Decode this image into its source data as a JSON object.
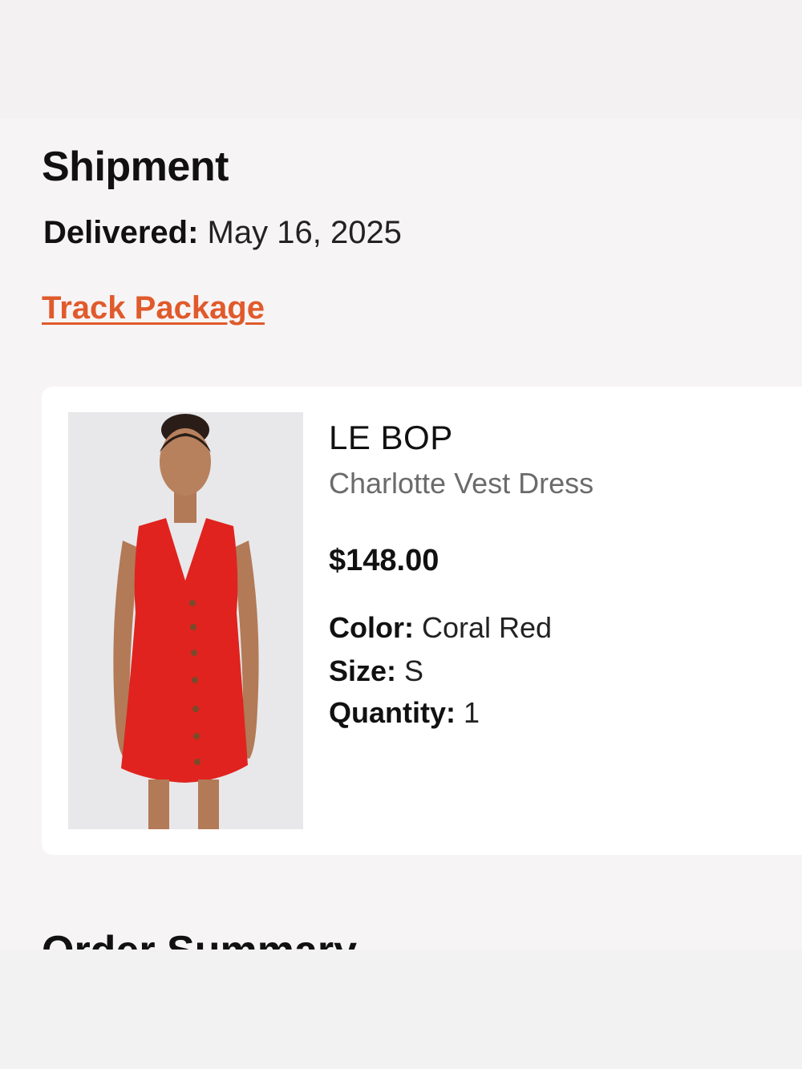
{
  "shipment": {
    "title": "Shipment",
    "delivered_label": "Delivered:",
    "delivered_date": "May 16, 2025",
    "track_link": "Track Package"
  },
  "item": {
    "brand": "LE BOP",
    "name": "Charlotte Vest Dress",
    "price": "$148.00",
    "color_label": "Color:",
    "color_value": "Coral Red",
    "size_label": "Size:",
    "size_value": "S",
    "quantity_label": "Quantity:",
    "quantity_value": "1",
    "image_icon": "product-photo"
  },
  "next_section": {
    "title": "Order Summary"
  },
  "colors": {
    "link": "#e05a2b",
    "dress": "#e0231f",
    "page_bg": "#f7f4f5",
    "card_bg": "#ffffff"
  }
}
